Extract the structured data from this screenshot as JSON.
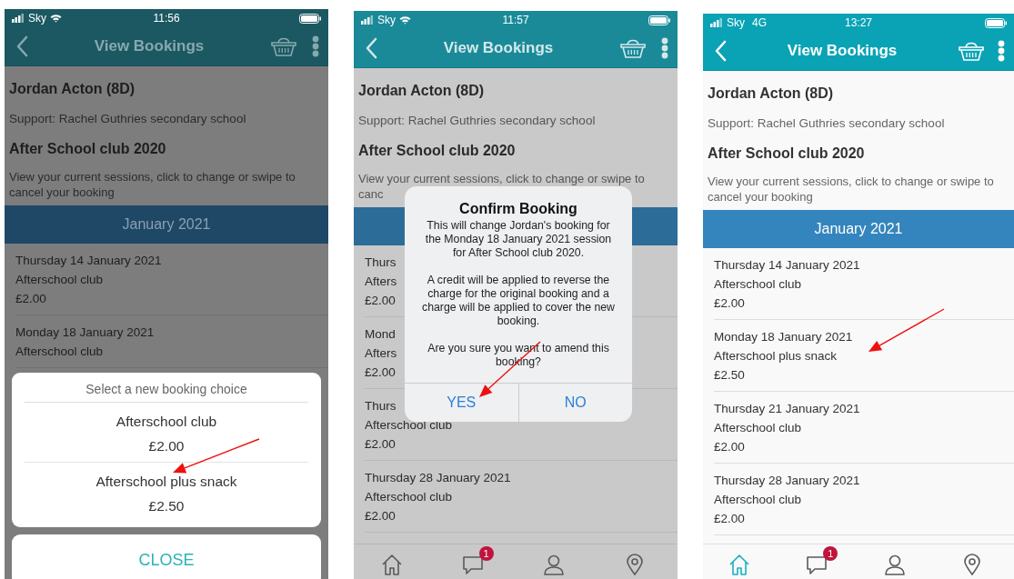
{
  "screens": [
    {
      "status_bar": {
        "carrier": "Sky",
        "wifi": true,
        "time": "11:56"
      },
      "header": {
        "title": "View Bookings"
      },
      "student": "Jordan Acton (8D)",
      "support": "Support: Rachel Guthries secondary school",
      "club": "After School club 2020",
      "instructions": "View your current sessions, click to change or swipe to cancel your booking",
      "month": "January 2021",
      "sessions": [
        {
          "date": "Thursday 14 January 2021",
          "choice": "Afterschool club",
          "price": "£2.00"
        },
        {
          "date": "Monday 18 January 2021",
          "choice": "Afterschool club"
        }
      ],
      "overlay": {
        "kind": "action_sheet",
        "title": "Select a new booking choice",
        "options": [
          {
            "name": "Afterschool club",
            "price": "£2.00"
          },
          {
            "name": "Afterschool plus snack",
            "price": "£2.50"
          }
        ],
        "close": "CLOSE"
      },
      "annotation_arrow": true
    },
    {
      "status_bar": {
        "carrier": "Sky",
        "wifi": true,
        "time": "11:57"
      },
      "header": {
        "title": "View Bookings"
      },
      "student": "Jordan Acton (8D)",
      "support": "Support: Rachel Guthries secondary school",
      "club": "After School club 2020",
      "instructions": "View your current sessions, click to change or swipe to canc",
      "sessions": [
        {
          "date": "Thurs",
          "choice": "Afters",
          "price": "£2.00"
        },
        {
          "date": "Mond",
          "choice": "Afters",
          "price": "£2.00"
        },
        {
          "date": "Thurs",
          "choice": "Afterschool club",
          "price": "£2.00"
        },
        {
          "date": "Thursday 28 January 2021",
          "choice": "Afterschool club",
          "price": "£2.00"
        }
      ],
      "overlay": {
        "kind": "alert",
        "title": "Confirm Booking",
        "message": [
          "This will change Jordan's booking for the Monday 18 January 2021 session for After School club 2020.",
          "A credit will be applied to reverse the charge for the original booking and a charge will be applied to cover the new booking.",
          "Are you sure you want to amend this booking?"
        ],
        "buttons": [
          "YES",
          "NO"
        ]
      },
      "tab_bar": [
        {
          "kind": "home",
          "selected": false
        },
        {
          "kind": "messages",
          "badge": "1",
          "selected": false
        },
        {
          "kind": "profile",
          "selected": false
        },
        {
          "kind": "location",
          "selected": false
        }
      ],
      "annotation_arrow": true
    },
    {
      "status_bar": {
        "carrier": "Sky",
        "network": "4G",
        "time": "13:27"
      },
      "header": {
        "title": "View Bookings"
      },
      "student": "Jordan Acton (8D)",
      "support": "Support: Rachel Guthries secondary school",
      "club": "After School club 2020",
      "instructions": "View your current sessions, click to change or swipe to cancel your booking",
      "month": "January 2021",
      "sessions": [
        {
          "date": "Thursday 14 January 2021",
          "choice": "Afterschool club",
          "price": "£2.00"
        },
        {
          "date": "Monday 18 January 2021",
          "choice": "Afterschool plus snack",
          "price": "£2.50"
        },
        {
          "date": "Thursday 21 January 2021",
          "choice": "Afterschool club",
          "price": "£2.00"
        },
        {
          "date": "Thursday 28 January 2021",
          "choice": "Afterschool club",
          "price": "£2.00"
        }
      ],
      "tab_bar": [
        {
          "kind": "home",
          "selected": true
        },
        {
          "kind": "messages",
          "badge": "1",
          "selected": false
        },
        {
          "kind": "profile",
          "selected": false
        },
        {
          "kind": "location",
          "selected": false
        }
      ],
      "annotation_arrow": true
    }
  ]
}
